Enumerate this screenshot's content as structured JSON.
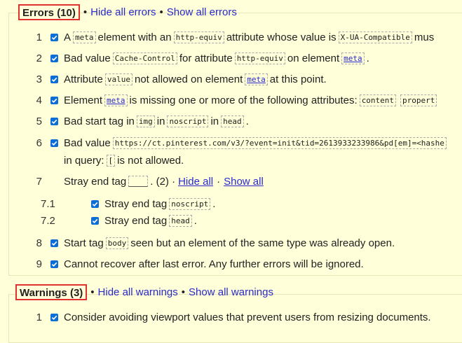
{
  "errors": {
    "title": "Errors (10)",
    "hide_all": "Hide all errors",
    "show_all": "Show all errors",
    "bullet": "•",
    "items": [
      {
        "num": "1",
        "a": "A",
        "c1": "meta",
        "b": "element with an",
        "c2": "http-equiv",
        "c": "attribute whose value is",
        "c3": "X-UA-Compatible",
        "d": "mus"
      },
      {
        "num": "2",
        "a": "Bad value",
        "c1": "Cache-Control",
        "b": "for attribute",
        "c2": "http-equiv",
        "c": "on element",
        "c3": "meta",
        "d": "."
      },
      {
        "num": "3",
        "a": "Attribute",
        "c1": "value",
        "b": "not allowed on element",
        "c2": "meta",
        "c": "at this point."
      },
      {
        "num": "4",
        "a": "Element",
        "c1": "meta",
        "b": "is missing one or more of the following attributes:",
        "c2": "content",
        "c3": "propert"
      },
      {
        "num": "5",
        "a": "Bad start tag in",
        "c1": "img",
        "b": "in",
        "c2": "noscript",
        "c": "in",
        "c3": "head",
        "d": "."
      },
      {
        "num": "6",
        "a": "Bad value",
        "c1": "https://ct.pinterest.com/v3/?event=init&tid=2613933233986&pd[em]=<hashe",
        "line2a": "in query:",
        "c2": "[",
        "line2b": "is not allowed."
      },
      {
        "num": "7",
        "a": "Stray end tag",
        "c1": "",
        "b": ". (2) ·",
        "hide_all": "Hide all",
        "sep": "·",
        "show_all": "Show all"
      },
      {
        "num": "7.1",
        "a": "Stray end tag",
        "c1": "noscript",
        "d": "."
      },
      {
        "num": "7.2",
        "a": "Stray end tag",
        "c1": "head",
        "d": "."
      },
      {
        "num": "8",
        "a": "Start tag",
        "c1": "body",
        "b": "seen but an element of the same type was already open."
      },
      {
        "num": "9",
        "a": "Cannot recover after last error. Any further errors will be ignored."
      }
    ]
  },
  "warnings": {
    "title": "Warnings (3)",
    "hide_all": "Hide all warnings",
    "show_all": "Show all warnings",
    "bullet": "•",
    "items": [
      {
        "num": "1",
        "a": "Consider avoiding viewport values that prevent users from resizing documents."
      }
    ]
  }
}
